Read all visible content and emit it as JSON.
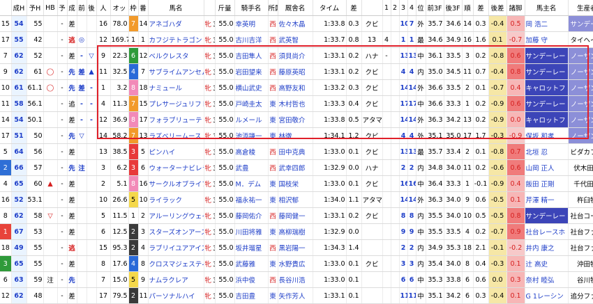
{
  "headers": [
    "",
    "成H",
    "予H",
    "HB",
    "予",
    "成",
    "前",
    "後",
    "人",
    "オッ",
    "枠",
    "番",
    "馬名",
    "",
    "斤量",
    "騎手名",
    "所属",
    "厩舎名",
    "タイム",
    "差",
    "",
    "1",
    "2",
    "3",
    "4",
    "位",
    "前3F",
    "後3F",
    "順",
    "差",
    "後差",
    "諸脚",
    "馬主名",
    "生産者名"
  ],
  "rows": [
    {
      "rn": "15",
      "seiH": "54",
      "yoH": "55",
      "hb": "",
      "yo": "-",
      "sei": "差",
      "mae": "",
      "ato": "",
      "pop": "16",
      "odds": "78.0",
      "waku": "7",
      "uma": "14",
      "name": "アネゴハダ",
      "sex": "牝",
      "age": "3",
      "kin": "55.0",
      "jockey": "幸英明",
      "shozoku": "西",
      "trainer": "佐々木晶",
      "time": "1:33.8",
      "sa": "0.3",
      "kubi": "クビ",
      "c1": "",
      "c2": "",
      "c3": "10",
      "c4": "7",
      "pos": "外",
      "f3": "35.7",
      "l3": "34.6",
      "jun": "14",
      "sa2": "0.3",
      "atosa": "-0.4",
      "shoashi": "0.5",
      "owner": "岡 浩二",
      "breeder": "サンデーヒル"
    },
    {
      "rn": "17",
      "seiH": "55",
      "yoH": "42",
      "hb": "",
      "yo": "-",
      "sei": "逃",
      "mae": "◎",
      "ato": "",
      "pop": "12",
      "odds": "169.7",
      "waku": "1",
      "uma": "1",
      "name": "カフジテトラゴン",
      "sex": "牝",
      "age": "3",
      "kin": "55.0",
      "jockey": "古川吉洋",
      "shozoku": "西",
      "trainer": "武英智",
      "time": "1:33.7",
      "sa": "0.8",
      "kubi": "13",
      "c1": "4",
      "c2": "",
      "c3": "1",
      "c4": "1",
      "pos": "最",
      "f3": "34.6",
      "l3": "34.9",
      "jun": "16",
      "sa2": "1.6",
      "atosa": "0.1",
      "shoashi": "-0.7",
      "owner": "加藤 守",
      "breeder": "タイヘイ牧場"
    },
    {
      "rn": "7",
      "seiH": "62",
      "yoH": "52",
      "hb": "",
      "yo": "-",
      "sei": "差",
      "mae": "-",
      "ato": "▽",
      "pop": "9",
      "odds": "22.3",
      "waku": "6",
      "uma": "12",
      "name": "ベルクレスタ",
      "sex": "牝",
      "age": "3",
      "kin": "55.0",
      "jockey": "吉田隼人",
      "shozoku": "西",
      "trainer": "須貝尚介",
      "time": "1:33.1",
      "sa": "0.2",
      "kubi": "ハナ",
      "c1": "-",
      "c2": "",
      "c3": "13",
      "c4": "13",
      "pos": "中",
      "f3": "36.1",
      "l3": "33.5",
      "jun": "3",
      "sa2": "0.2",
      "atosa": "-0.8",
      "shoashi": "0.6",
      "owner": "サンデーレー",
      "breeder": "ノーザンファ"
    },
    {
      "rn": "9",
      "seiH": "62",
      "yoH": "61",
      "hb": "◯",
      "yo": "-",
      "sei": "先",
      "mae": "差",
      "ato": "▲",
      "pop": "11",
      "odds": "32.5",
      "waku": "4",
      "uma": "7",
      "name": "サブライムアンセム",
      "sex": "牝",
      "age": "3",
      "kin": "55.0",
      "jockey": "岩田望来",
      "shozoku": "西",
      "trainer": "藤原英昭",
      "time": "1:33.1",
      "sa": "0.2",
      "kubi": "クビ",
      "c1": "",
      "c2": "",
      "c3": "4",
      "c4": "4",
      "pos": "内",
      "f3": "35.0",
      "l3": "34.5",
      "jun": "11",
      "sa2": "0.7",
      "atosa": "-0.4",
      "shoashi": "0.8",
      "owner": "サンデーレー",
      "breeder": "ノーザンファ"
    },
    {
      "rn": "10",
      "seiH": "61",
      "yoH": "61.1",
      "hb": "◯",
      "yo": "-",
      "sei": "先",
      "mae": "差",
      "ato": "-",
      "pop": "1",
      "odds": "3.2",
      "waku": "8",
      "uma": "18",
      "name": "ナミュール",
      "sex": "牝",
      "age": "3",
      "kin": "55.0",
      "jockey": "横山武史",
      "shozoku": "西",
      "trainer": "高野友和",
      "time": "1:33.2",
      "sa": "0.3",
      "kubi": "クビ",
      "c1": "",
      "c2": "",
      "c3": "14",
      "c4": "14",
      "pos": "外",
      "f3": "36.6",
      "l3": "33.5",
      "jun": "2",
      "sa2": "0.1",
      "atosa": "-0.7",
      "shoashi": "0.4",
      "owner": "キャロットフ",
      "breeder": "ノーザンファ"
    },
    {
      "rn": "11",
      "seiH": "58",
      "yoH": "56.1",
      "hb": "",
      "yo": "-",
      "sei": "追",
      "mae": "-",
      "ato": "-",
      "pop": "4",
      "odds": "11.3",
      "waku": "7",
      "uma": "15",
      "name": "プレサージュリフト",
      "sex": "牝",
      "age": "3",
      "kin": "55.0",
      "jockey": "戸崎圭太",
      "shozoku": "東",
      "trainer": "木村哲也",
      "time": "1:33.3",
      "sa": "0.4",
      "kubi": "クビ",
      "c1": "",
      "c2": "",
      "c3": "17",
      "c4": "17",
      "pos": "中",
      "f3": "36.6",
      "l3": "33.3",
      "jun": "1",
      "sa2": "0.2",
      "atosa": "-0.9",
      "shoashi": "0.6",
      "owner": "サンデーレー",
      "breeder": "ノーザンファ"
    },
    {
      "rn": "14",
      "seiH": "54",
      "yoH": "50.1",
      "hb": "",
      "yo": "-",
      "sei": "差",
      "mae": "-",
      "ato": "-",
      "pop": "12",
      "odds": "36.9",
      "waku": "8",
      "uma": "17",
      "name": "フォラブリューテ",
      "sex": "牝",
      "age": "3",
      "kin": "55.0",
      "jockey": "ルメール",
      "shozoku": "東",
      "trainer": "宮田敬介",
      "time": "1:33.8",
      "sa": "0.5",
      "kubi": "アタマ",
      "c1": "",
      "c2": "",
      "c3": "14",
      "c4": "14",
      "pos": "外",
      "f3": "36.3",
      "l3": "34.2",
      "jun": "13",
      "sa2": "0.2",
      "atosa": "-0.9",
      "shoashi": "0.0",
      "owner": "キャロットフ",
      "breeder": "ノーザンファ"
    },
    {
      "rn": "17",
      "seiH": "51",
      "yoH": "50",
      "hb": "",
      "yo": "-",
      "sei": "先",
      "mae": "▽",
      "ato": "",
      "pop": "14",
      "odds": "58.2",
      "waku": "7",
      "uma": "13",
      "name": "ラズベリームース",
      "sex": "牝",
      "age": "3",
      "kin": "55.0",
      "jockey": "池添謙一",
      "shozoku": "東",
      "trainer": "林徹",
      "time": "1:34.1",
      "sa": "1.2",
      "kubi": "クビ",
      "c1": "",
      "c2": "",
      "c3": "4",
      "c4": "4",
      "pos": "外",
      "f3": "35.1",
      "l3": "35.0",
      "jun": "17",
      "sa2": "1.7",
      "atosa": "-0.3",
      "shoashi": "-0.9",
      "owner": "保坂 和孝",
      "breeder": "ノーザンファ"
    },
    {
      "rn": "5",
      "seiH": "64",
      "yoH": "56",
      "hb": "",
      "yo": "-",
      "sei": "差",
      "mae": "",
      "ato": "",
      "pop": "13",
      "odds": "38.5",
      "waku": "3",
      "uma": "5",
      "name": "ピンハイ",
      "sex": "牝",
      "age": "3",
      "kin": "55.0",
      "jockey": "高倉稜",
      "shozoku": "西",
      "trainer": "田中克典",
      "time": "1:33.0",
      "sa": "0.1",
      "kubi": "クビ",
      "c1": "",
      "c2": "",
      "c3": "13",
      "c4": "13",
      "pos": "最",
      "f3": "35.7",
      "l3": "33.4",
      "jun": "2",
      "sa2": "0.1",
      "atosa": "-0.8",
      "shoashi": "0.7",
      "owner": "北垣 忍",
      "breeder": "ビダカファー"
    },
    {
      "rn": "2",
      "seiH": "66",
      "yoH": "57",
      "hb": "",
      "yo": "-",
      "sei": "先",
      "mae": "注",
      "ato": "",
      "pop": "3",
      "odds": "6.2",
      "waku": "3",
      "uma": "6",
      "name": "ウォーターナビレラ",
      "sex": "牝",
      "age": "3",
      "kin": "55.0",
      "jockey": "武豊",
      "shozoku": "西",
      "trainer": "武幸四郎",
      "time": "1:32.9",
      "sa": "0.0",
      "kubi": "ハナ",
      "c1": "",
      "c2": "",
      "c3": "2",
      "c4": "2",
      "pos": "内",
      "f3": "34.8",
      "l3": "34.0",
      "jun": "11",
      "sa2": "0.2",
      "atosa": "-0.6",
      "shoashi": "0.6",
      "owner": "山岡 正人",
      "breeder": "伏木田牧場"
    },
    {
      "rn": "4",
      "seiH": "65",
      "yoH": "60",
      "hb": "▲",
      "yo": "-",
      "sei": "差",
      "mae": "",
      "ato": "",
      "pop": "2",
      "odds": "5.1",
      "waku": "8",
      "uma": "16",
      "name": "サークルオブライフ",
      "sex": "牝",
      "age": "3",
      "kin": "55.0",
      "jockey": "M．デム",
      "shozoku": "東",
      "trainer": "国枝栄",
      "time": "1:33.0",
      "sa": "0.1",
      "kubi": "クビ",
      "c1": "",
      "c2": "",
      "c3": "16",
      "c4": "16",
      "pos": "中",
      "f3": "36.4",
      "l3": "33.3",
      "jun": "1",
      "sa2": "-0.1",
      "atosa": "-0.9",
      "shoashi": "0.4",
      "owner": "飯田 正剛",
      "breeder": "千代田牧場"
    },
    {
      "rn": "16",
      "seiH": "52",
      "yoH": "53.1",
      "hb": "",
      "yo": "-",
      "sei": "差",
      "mae": "",
      "ato": "",
      "pop": "10",
      "odds": "26.6",
      "waku": "5",
      "uma": "10",
      "name": "ライラック",
      "sex": "牝",
      "age": "3",
      "kin": "55.0",
      "jockey": "福永祐一",
      "shozoku": "東",
      "trainer": "相沢郁",
      "time": "1:34.0",
      "sa": "1.1",
      "kubi": "アタマ",
      "c1": "",
      "c2": "",
      "c3": "14",
      "c4": "14",
      "pos": "外",
      "f3": "36.3",
      "l3": "34.0",
      "jun": "9",
      "sa2": "0.6",
      "atosa": "-0.5",
      "shoashi": "0.1",
      "owner": "芹澤 精一",
      "breeder": "杵臼牧場"
    },
    {
      "rn": "8",
      "seiH": "62",
      "yoH": "58",
      "hb": "▽",
      "yo": "-",
      "sei": "差",
      "mae": "",
      "ato": "",
      "pop": "5",
      "odds": "11.5",
      "waku": "1",
      "uma": "2",
      "name": "アルーリングウェイ",
      "sex": "牝",
      "age": "3",
      "kin": "55.0",
      "jockey": "藤岡佑介",
      "shozoku": "西",
      "trainer": "藤岡健一",
      "time": "1:33.1",
      "sa": "0.2",
      "kubi": "クビ",
      "c1": "",
      "c2": "",
      "c3": "8",
      "c4": "8",
      "pos": "内",
      "f3": "35.5",
      "l3": "34.0",
      "jun": "10",
      "sa2": "0.5",
      "atosa": "-0.5",
      "shoashi": "0.8",
      "owner": "サンデーレー",
      "breeder": "社台コーポレ"
    },
    {
      "rn": "1",
      "seiH": "67",
      "yoH": "53",
      "hb": "",
      "yo": "-",
      "sei": "差",
      "mae": "",
      "ato": "",
      "pop": "6",
      "odds": "12.5",
      "waku": "2",
      "uma": "3",
      "name": "スターズオンアース",
      "sex": "牝",
      "age": "3",
      "kin": "55.0",
      "jockey": "川田将雅",
      "shozoku": "東",
      "trainer": "高柳瑞樹",
      "time": "1:32.9",
      "sa": "0.0",
      "kubi": "",
      "c1": "",
      "c2": "",
      "c3": "9",
      "c4": "9",
      "pos": "中",
      "f3": "35.5",
      "l3": "33.5",
      "jun": "4",
      "sa2": "0.2",
      "atosa": "-0.7",
      "shoashi": "0.9",
      "owner": "社台レースホ",
      "breeder": "社台ファーム"
    },
    {
      "rn": "18",
      "seiH": "49",
      "yoH": "55",
      "hb": "",
      "yo": "-",
      "sei": "逃",
      "mae": "",
      "ato": "",
      "pop": "15",
      "odds": "95.3",
      "waku": "2",
      "uma": "4",
      "name": "ラブリイユアアイズ",
      "sex": "牝",
      "age": "3",
      "kin": "55.0",
      "jockey": "坂井瑠星",
      "shozoku": "西",
      "trainer": "黒岩陽一",
      "time": "1:34.3",
      "sa": "1.4",
      "kubi": "",
      "c1": "",
      "c2": "",
      "c3": "2",
      "c4": "2",
      "pos": "内",
      "f3": "34.9",
      "l3": "35.3",
      "jun": "18",
      "sa2": "2.1",
      "atosa": "-0.1",
      "shoashi": "-0.2",
      "owner": "井内 康之",
      "breeder": "社台ファーム"
    },
    {
      "rn": "3",
      "seiH": "65",
      "yoH": "55",
      "hb": "",
      "yo": "-",
      "sei": "差",
      "mae": "",
      "ato": "",
      "pop": "8",
      "odds": "17.6",
      "waku": "4",
      "uma": "8",
      "name": "クロスマジェスティ",
      "sex": "牝",
      "age": "3",
      "kin": "55.0",
      "jockey": "武藤雅",
      "shozoku": "東",
      "trainer": "水野貴広",
      "time": "1:33.0",
      "sa": "0.1",
      "kubi": "クビ",
      "c1": "",
      "c2": "",
      "c3": "3",
      "c4": "3",
      "pos": "内",
      "f3": "35.4",
      "l3": "34.0",
      "jun": "8",
      "sa2": "0.4",
      "atosa": "-0.3",
      "shoashi": "0.1",
      "owner": "辻 高史",
      "breeder": "沖田牧場"
    },
    {
      "rn": "6",
      "seiH": "63",
      "yoH": "59",
      "hb": "注",
      "yo": "-",
      "sei": "先",
      "mae": "",
      "ato": "",
      "pop": "7",
      "odds": "15.0",
      "waku": "5",
      "uma": "9",
      "name": "ナムラクレア",
      "sex": "牝",
      "age": "3",
      "kin": "55.0",
      "jockey": "浜中俊",
      "shozoku": "西",
      "trainer": "長谷川浩",
      "time": "1:33.0",
      "sa": "0.1",
      "kubi": "",
      "c1": "",
      "c2": "",
      "c3": "6",
      "c4": "6",
      "pos": "中",
      "f3": "35.3",
      "l3": "33.8",
      "jun": "6",
      "sa2": "0.6",
      "atosa": "0.0",
      "shoashi": "0.3",
      "owner": "奈村 睦弘",
      "breeder": "谷川牧場"
    },
    {
      "rn": "12",
      "seiH": "62",
      "yoH": "48",
      "hb": "",
      "yo": "-",
      "sei": "差",
      "mae": "",
      "ato": "",
      "pop": "17",
      "odds": "79.5",
      "waku": "2",
      "uma": "11",
      "name": "パーソナルハイ",
      "sex": "牝",
      "age": "3",
      "kin": "55.0",
      "jockey": "吉田豊",
      "shozoku": "東",
      "trainer": "矢作芳人",
      "time": "1:33.1",
      "sa": "0.1",
      "kubi": "",
      "c1": "",
      "c2": "",
      "c3": "11",
      "c4": "11",
      "pos": "中",
      "f3": "35.1",
      "l3": "34.2",
      "jun": "6",
      "sa2": "0.3",
      "atosa": "-0.4",
      "shoashi": "0.1",
      "owner": "G 1レーシン",
      "breeder": "追分ファーム"
    }
  ],
  "colors": {
    "waku": {
      "1": "#ffffff",
      "2": "#3a3a3a",
      "3": "#e83a3a",
      "4": "#2a6ad8",
      "5": "#f5d84a",
      "6": "#2e9a3a",
      "7": "#f29a2a",
      "8": "#f28ab8"
    },
    "highlight": "#e0202a"
  }
}
